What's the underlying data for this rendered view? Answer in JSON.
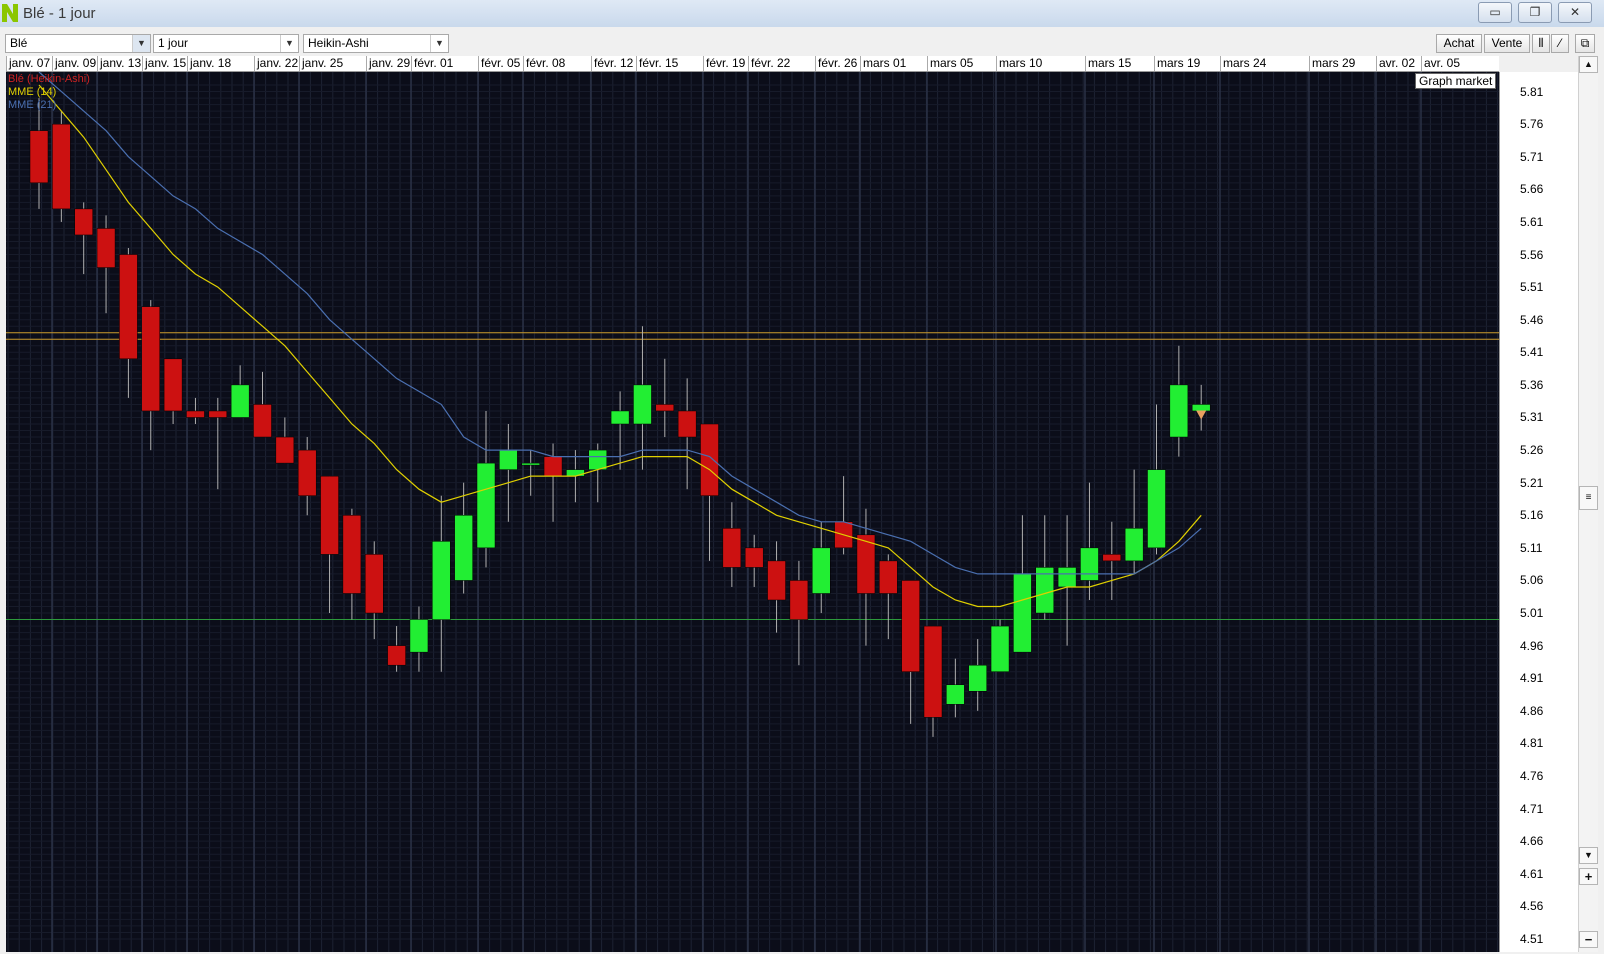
{
  "window": {
    "title": "Blé - 1 jour",
    "brand_color": "#8bc600"
  },
  "toolbar": {
    "instrument": "Blé",
    "period": "1 jour",
    "chart_type": "Heikin-Ashi",
    "buy_label": "Achat",
    "sell_label": "Vente"
  },
  "dates": [
    "janv. 07",
    "janv. 09",
    "janv. 13",
    "janv. 15",
    "janv. 18",
    "janv. 22",
    "janv. 25",
    "janv. 29",
    "févr. 01",
    "févr. 05",
    "févr. 08",
    "févr. 12",
    "févr. 15",
    "févr. 19",
    "févr. 22",
    "févr. 26",
    "mars 01",
    "mars 05",
    "mars 10",
    "mars 15",
    "mars 19",
    "mars 24",
    "mars 29",
    "avr. 02",
    "avr. 05"
  ],
  "legend": [
    {
      "label": "Blé (Heikin-Ashi)",
      "color": "#cc2222"
    },
    {
      "label": "MME (14)",
      "color": "#e0d000"
    },
    {
      "label": "MME (21)",
      "color": "#4a6fb0"
    }
  ],
  "graph_label": "Graph market",
  "y_ticks": [
    "5.81",
    "5.76",
    "5.71",
    "5.66",
    "5.61",
    "5.56",
    "5.51",
    "5.46",
    "5.41",
    "5.36",
    "5.31",
    "5.26",
    "5.21",
    "5.16",
    "5.11",
    "5.06",
    "5.01",
    "4.96",
    "4.91",
    "4.86",
    "4.81",
    "4.76",
    "4.71",
    "4.66",
    "4.61",
    "4.56",
    "4.51"
  ],
  "chart_data": {
    "type": "candlestick",
    "title": "Blé",
    "series": [
      {
        "name": "Blé (Heikin-Ashi)",
        "candles": [
          {
            "o": 5.75,
            "c": 5.67,
            "h": 5.8,
            "l": 5.63
          },
          {
            "o": 5.76,
            "c": 5.63,
            "h": 5.78,
            "l": 5.61
          },
          {
            "o": 5.63,
            "c": 5.59,
            "h": 5.64,
            "l": 5.53
          },
          {
            "o": 5.6,
            "c": 5.54,
            "h": 5.62,
            "l": 5.47
          },
          {
            "o": 5.56,
            "c": 5.4,
            "h": 5.57,
            "l": 5.34
          },
          {
            "o": 5.48,
            "c": 5.32,
            "h": 5.49,
            "l": 5.26
          },
          {
            "o": 5.4,
            "c": 5.32,
            "h": 5.4,
            "l": 5.3
          },
          {
            "o": 5.32,
            "c": 5.31,
            "h": 5.34,
            "l": 5.3
          },
          {
            "o": 5.32,
            "c": 5.31,
            "h": 5.34,
            "l": 5.2
          },
          {
            "o": 5.31,
            "c": 5.36,
            "h": 5.39,
            "l": 5.31
          },
          {
            "o": 5.33,
            "c": 5.28,
            "h": 5.38,
            "l": 5.28
          },
          {
            "o": 5.28,
            "c": 5.24,
            "h": 5.31,
            "l": 5.24
          },
          {
            "o": 5.26,
            "c": 5.19,
            "h": 5.28,
            "l": 5.16
          },
          {
            "o": 5.22,
            "c": 5.1,
            "h": 5.22,
            "l": 5.01
          },
          {
            "o": 5.16,
            "c": 5.04,
            "h": 5.17,
            "l": 5.0
          },
          {
            "o": 5.1,
            "c": 5.01,
            "h": 5.12,
            "l": 4.97
          },
          {
            "o": 4.96,
            "c": 4.93,
            "h": 4.99,
            "l": 4.92
          },
          {
            "o": 4.95,
            "c": 5.0,
            "h": 5.02,
            "l": 4.92
          },
          {
            "o": 5.0,
            "c": 5.12,
            "h": 5.19,
            "l": 4.92
          },
          {
            "o": 5.06,
            "c": 5.16,
            "h": 5.21,
            "l": 5.04
          },
          {
            "o": 5.11,
            "c": 5.24,
            "h": 5.32,
            "l": 5.08
          },
          {
            "o": 5.23,
            "c": 5.26,
            "h": 5.3,
            "l": 5.15
          },
          {
            "o": 5.24,
            "c": 5.24,
            "h": 5.26,
            "l": 5.19
          },
          {
            "o": 5.25,
            "c": 5.22,
            "h": 5.27,
            "l": 5.15
          },
          {
            "o": 5.22,
            "c": 5.23,
            "h": 5.26,
            "l": 5.18
          },
          {
            "o": 5.23,
            "c": 5.26,
            "h": 5.27,
            "l": 5.18
          },
          {
            "o": 5.3,
            "c": 5.32,
            "h": 5.35,
            "l": 5.23
          },
          {
            "o": 5.3,
            "c": 5.36,
            "h": 5.45,
            "l": 5.23
          },
          {
            "o": 5.33,
            "c": 5.32,
            "h": 5.4,
            "l": 5.28
          },
          {
            "o": 5.32,
            "c": 5.28,
            "h": 5.37,
            "l": 5.2
          },
          {
            "o": 5.3,
            "c": 5.19,
            "h": 5.3,
            "l": 5.09
          },
          {
            "o": 5.14,
            "c": 5.08,
            "h": 5.18,
            "l": 5.05
          },
          {
            "o": 5.11,
            "c": 5.08,
            "h": 5.13,
            "l": 5.05
          },
          {
            "o": 5.09,
            "c": 5.03,
            "h": 5.12,
            "l": 4.98
          },
          {
            "o": 5.06,
            "c": 5.0,
            "h": 5.09,
            "l": 4.93
          },
          {
            "o": 5.04,
            "c": 5.11,
            "h": 5.15,
            "l": 5.01
          },
          {
            "o": 5.15,
            "c": 5.11,
            "h": 5.22,
            "l": 5.1
          },
          {
            "o": 5.13,
            "c": 5.04,
            "h": 5.17,
            "l": 4.96
          },
          {
            "o": 5.09,
            "c": 5.04,
            "h": 5.1,
            "l": 4.97
          },
          {
            "o": 5.06,
            "c": 4.92,
            "h": 5.06,
            "l": 4.84
          },
          {
            "o": 4.99,
            "c": 4.85,
            "h": 4.99,
            "l": 4.82
          },
          {
            "o": 4.87,
            "c": 4.9,
            "h": 4.94,
            "l": 4.85
          },
          {
            "o": 4.89,
            "c": 4.93,
            "h": 4.97,
            "l": 4.86
          },
          {
            "o": 4.92,
            "c": 4.99,
            "h": 5.0,
            "l": 4.92
          },
          {
            "o": 4.95,
            "c": 5.07,
            "h": 5.16,
            "l": 4.95
          },
          {
            "o": 5.01,
            "c": 5.08,
            "h": 5.16,
            "l": 5.0
          },
          {
            "o": 5.05,
            "c": 5.08,
            "h": 5.16,
            "l": 4.96
          },
          {
            "o": 5.06,
            "c": 5.11,
            "h": 5.21,
            "l": 5.03
          },
          {
            "o": 5.1,
            "c": 5.09,
            "h": 5.15,
            "l": 5.03
          },
          {
            "o": 5.09,
            "c": 5.14,
            "h": 5.23,
            "l": 5.07
          },
          {
            "o": 5.11,
            "c": 5.23,
            "h": 5.33,
            "l": 5.1
          },
          {
            "o": 5.28,
            "c": 5.36,
            "h": 5.42,
            "l": 5.25
          },
          {
            "o": 5.32,
            "c": 5.33,
            "h": 5.36,
            "l": 5.29
          }
        ]
      },
      {
        "name": "MME (14)",
        "values": [
          5.82,
          5.78,
          5.74,
          5.69,
          5.64,
          5.6,
          5.56,
          5.53,
          5.51,
          5.48,
          5.45,
          5.42,
          5.38,
          5.34,
          5.3,
          5.27,
          5.23,
          5.2,
          5.18,
          5.19,
          5.2,
          5.21,
          5.22,
          5.22,
          5.22,
          5.23,
          5.24,
          5.25,
          5.25,
          5.25,
          5.23,
          5.2,
          5.18,
          5.16,
          5.15,
          5.14,
          5.13,
          5.12,
          5.11,
          5.08,
          5.05,
          5.03,
          5.02,
          5.02,
          5.03,
          5.04,
          5.05,
          5.05,
          5.06,
          5.07,
          5.09,
          5.12,
          5.16
        ]
      },
      {
        "name": "MME (21)",
        "values": [
          5.84,
          5.81,
          5.78,
          5.75,
          5.71,
          5.68,
          5.65,
          5.63,
          5.6,
          5.58,
          5.56,
          5.53,
          5.5,
          5.46,
          5.43,
          5.4,
          5.37,
          5.35,
          5.33,
          5.28,
          5.26,
          5.26,
          5.26,
          5.25,
          5.25,
          5.25,
          5.25,
          5.26,
          5.26,
          5.26,
          5.25,
          5.22,
          5.2,
          5.18,
          5.16,
          5.15,
          5.15,
          5.14,
          5.13,
          5.12,
          5.1,
          5.08,
          5.07,
          5.07,
          5.07,
          5.07,
          5.07,
          5.07,
          5.07,
          5.07,
          5.09,
          5.11,
          5.14
        ]
      }
    ],
    "horizontal_lines": [
      {
        "value": 5.44,
        "color": "#c9992a"
      },
      {
        "value": 5.43,
        "color": "#c9992a"
      },
      {
        "value": 5.0,
        "color": "#2d9a3c"
      }
    ],
    "ylim": [
      4.49,
      5.84
    ],
    "xlabel": "",
    "ylabel": "",
    "colors": {
      "up": "#22ee33",
      "down": "#cc1111",
      "wick": "#b0b0b0",
      "background": "#0b0d19"
    }
  }
}
